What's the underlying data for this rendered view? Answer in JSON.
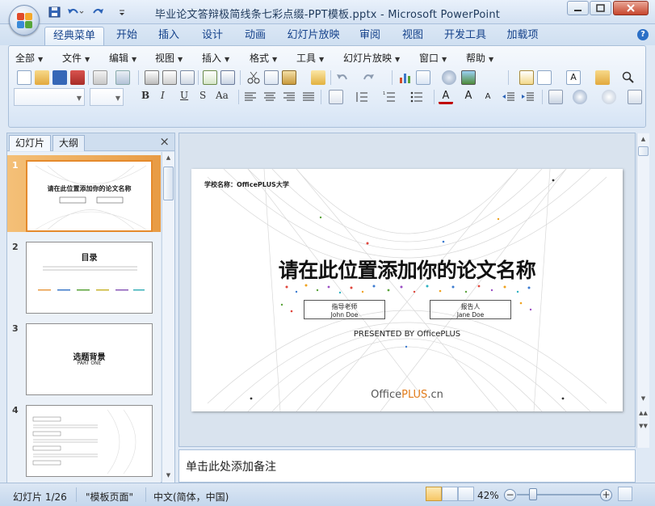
{
  "window": {
    "title": "毕业论文答辩极简线条七彩点缀-PPT模板.pptx - Microsoft PowerPoint"
  },
  "ribbon_tabs": [
    "经典菜单",
    "开始",
    "插入",
    "设计",
    "动画",
    "幻灯片放映",
    "审阅",
    "视图",
    "开发工具",
    "加载项"
  ],
  "classic_menu": [
    "全部",
    "文件",
    "编辑",
    "视图",
    "插入",
    "格式",
    "工具",
    "幻灯片放映",
    "窗口",
    "帮助"
  ],
  "format_buttons": [
    "B",
    "I",
    "U",
    "S",
    "Aa"
  ],
  "pane": {
    "tabs": [
      "幻灯片",
      "大纲"
    ],
    "close": "×"
  },
  "thumbnails": [
    {
      "num": "1",
      "title": "请在此位置添加你的论文名称"
    },
    {
      "num": "2",
      "title": "目录"
    },
    {
      "num": "3",
      "title": "选题背景",
      "sub": "PART ONE"
    },
    {
      "num": "4"
    }
  ],
  "slide": {
    "school": "学校名称：OfficePLUS大学",
    "title": "请在此位置添加你的论文名称",
    "advisor_role": "指导老师",
    "advisor_name": "John Doe",
    "reporter_role": "报告人",
    "reporter_name": "Jane Doe",
    "presented": "PRESENTED BY OfficePLUS",
    "brand_a": "Office",
    "brand_b": "PLUS",
    "brand_c": ".cn"
  },
  "notes_placeholder": "单击此处添加备注",
  "status": {
    "slide_index": "幻灯片 1/26",
    "theme": "\"模板页面\"",
    "language": "中文(简体，中国)",
    "zoom": "42%"
  },
  "colors": {
    "accent_orange": "#e89b44",
    "ribbon_blue": "#15428b"
  }
}
